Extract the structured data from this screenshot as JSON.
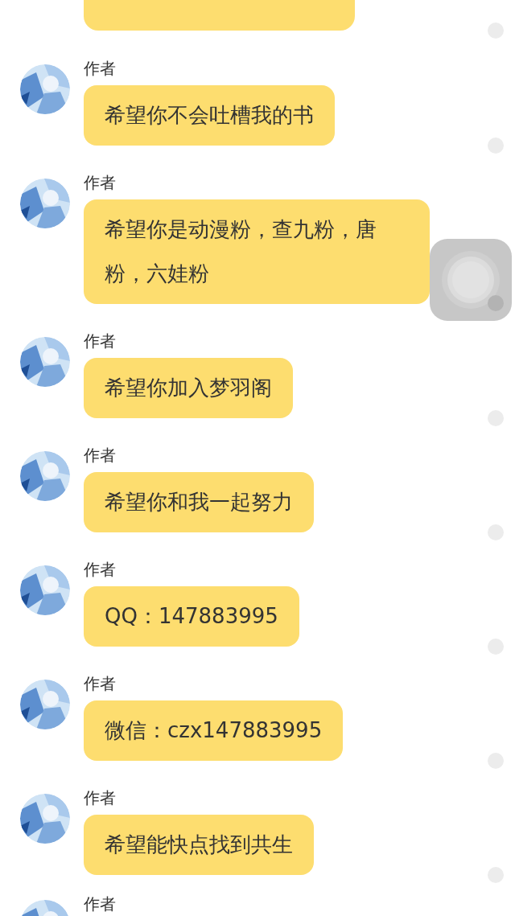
{
  "messages": [
    {
      "kind": "cut_top"
    },
    {
      "kind": "full",
      "sender": "作者",
      "text": "希望你不会吐槽我的书"
    },
    {
      "kind": "full",
      "sender": "作者",
      "text": "希望你是动漫粉，查九粉，唐粉，六娃粉"
    },
    {
      "kind": "full",
      "sender": "作者",
      "text": "希望你加入梦羽阁"
    },
    {
      "kind": "full",
      "sender": "作者",
      "text": "希望你和我一起努力"
    },
    {
      "kind": "full",
      "sender": "作者",
      "text": "QQ：147883995"
    },
    {
      "kind": "full",
      "sender": "作者",
      "text": "微信：czx147883995"
    },
    {
      "kind": "full",
      "sender": "作者",
      "text": "希望能快点找到共生"
    },
    {
      "kind": "cut_bottom",
      "sender": "作者"
    }
  ]
}
